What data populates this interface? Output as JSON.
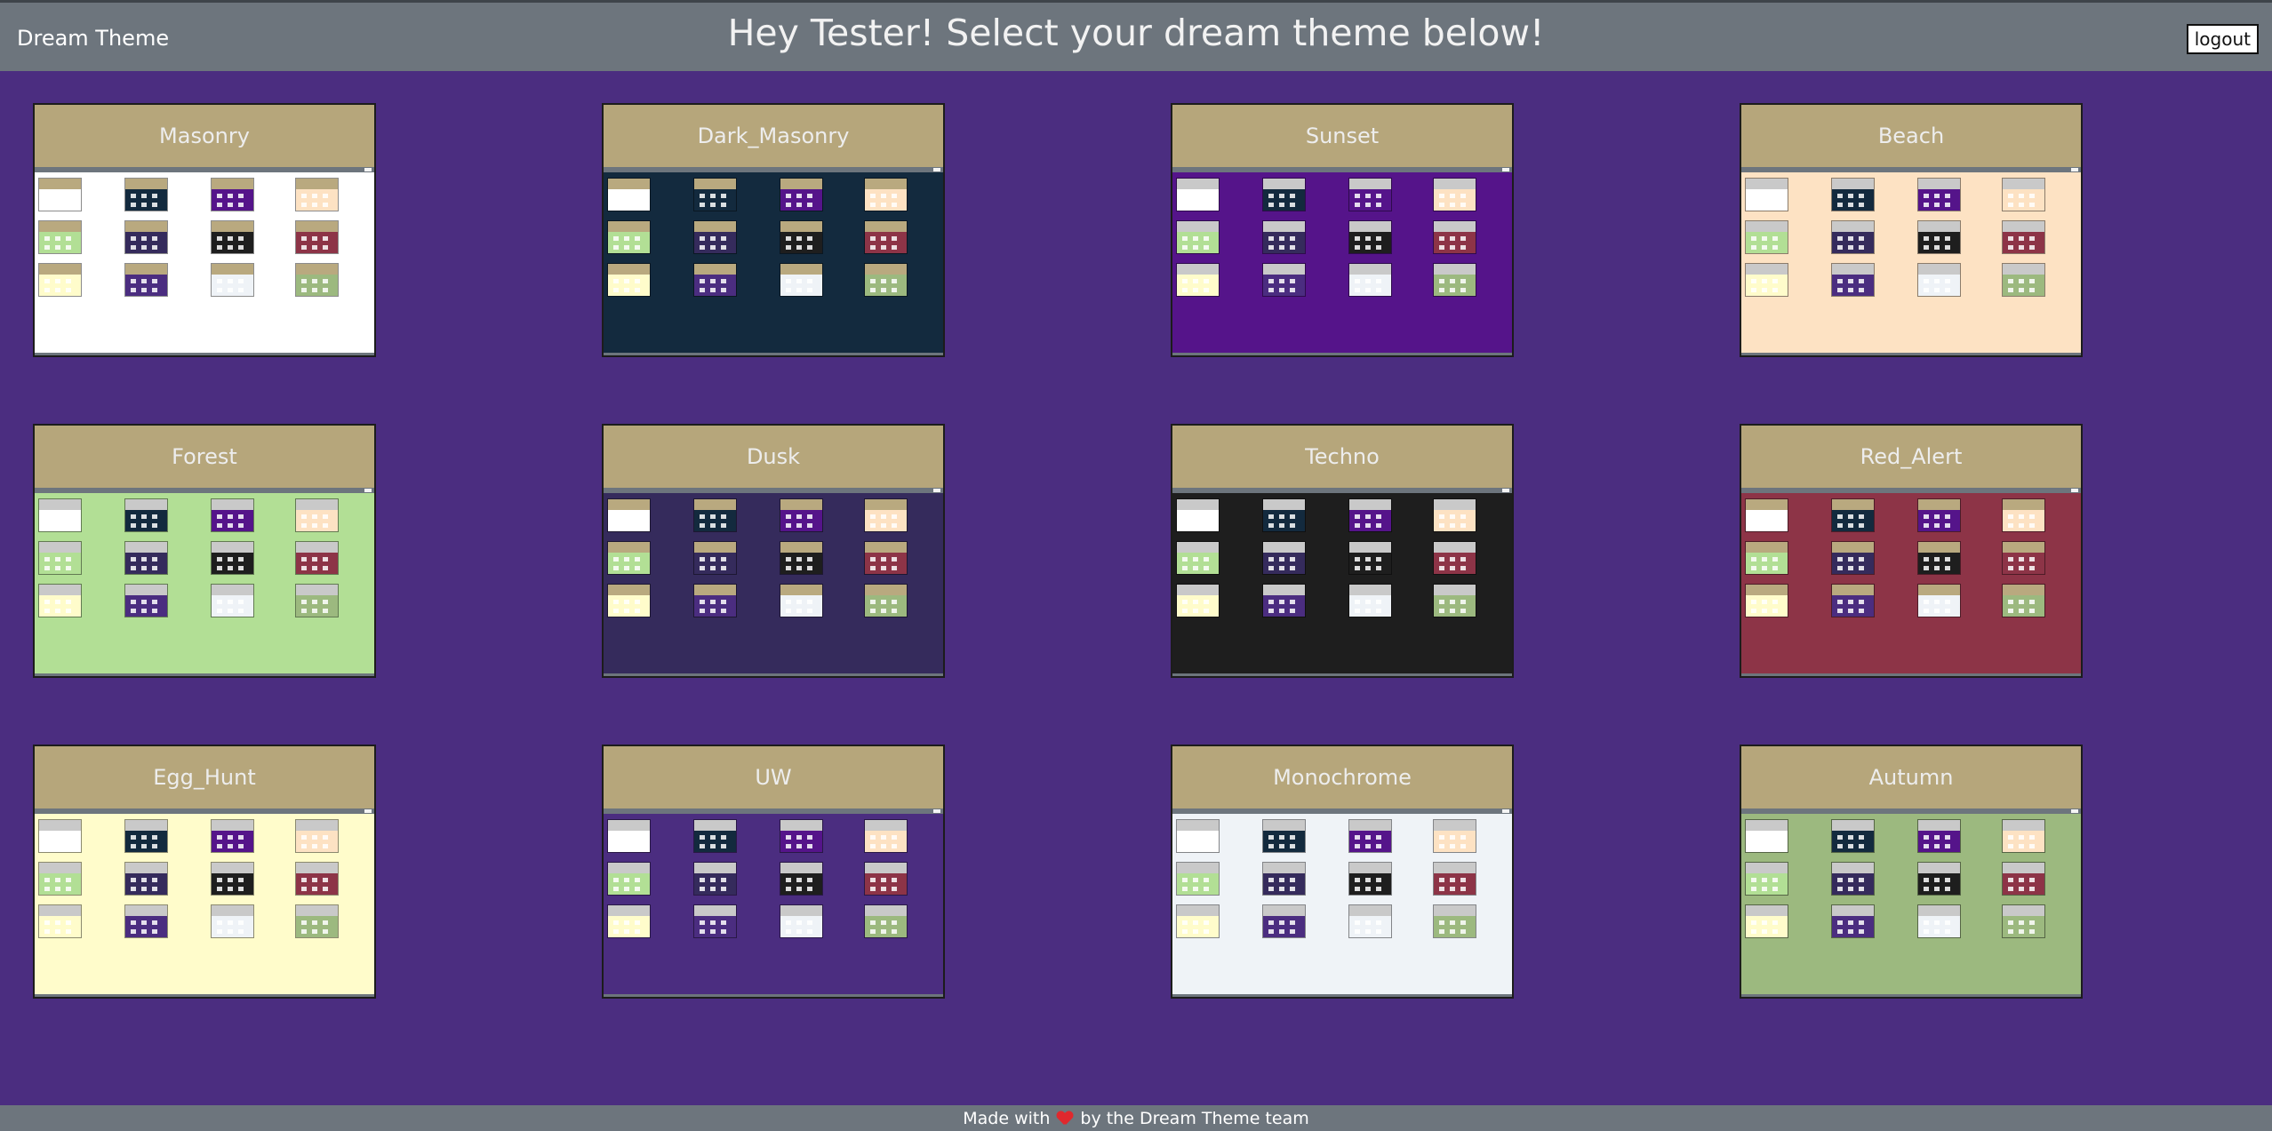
{
  "header": {
    "brand": "Dream Theme",
    "title": "Hey Tester! Select your dream theme below!",
    "logout_label": "logout"
  },
  "themes": [
    {
      "name": "Masonry",
      "bg": "#ffffff"
    },
    {
      "name": "Dark_Masonry",
      "bg": "#132a3e"
    },
    {
      "name": "Sunset",
      "bg": "#55148a"
    },
    {
      "name": "Beach",
      "bg": "#fde2c3"
    },
    {
      "name": "Forest",
      "bg": "#b2df95"
    },
    {
      "name": "Dusk",
      "bg": "#352b5c"
    },
    {
      "name": "Techno",
      "bg": "#1e1e1e"
    },
    {
      "name": "Red_Alert",
      "bg": "#8d3447"
    },
    {
      "name": "Egg_Hunt",
      "bg": "#fffccb"
    },
    {
      "name": "UW",
      "bg": "#4b2d80"
    },
    {
      "name": "Monochrome",
      "bg": "#eff3f7"
    },
    {
      "name": "Autumn",
      "bg": "#9cb97f"
    }
  ],
  "footer": {
    "made_with": "Made with",
    "by_team": "by the Dream Theme team"
  },
  "colors": {
    "page_bg": "#4b2d80",
    "navbar": "#6d757d",
    "card_header": "#b6a67b",
    "heart": "#e0282d"
  },
  "icons": {
    "heart": "heart-icon"
  }
}
